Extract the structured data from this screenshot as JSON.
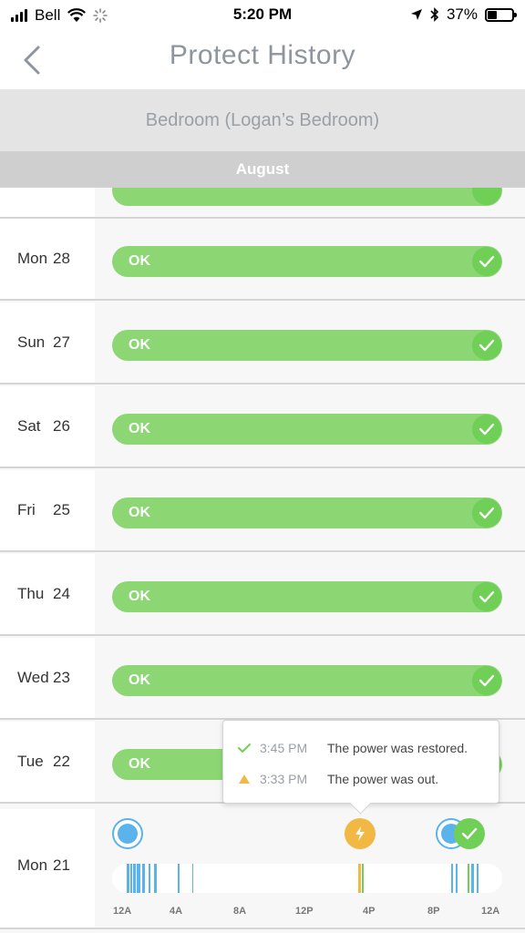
{
  "status_bar": {
    "carrier": "Bell",
    "time": "5:20 PM",
    "battery": "37%",
    "battery_level": 0.37
  },
  "nav": {
    "title": "Protect History"
  },
  "device": {
    "name": "Bedroom (Logan’s Bedroom)"
  },
  "month": "August",
  "rows": [
    {
      "day": "Mon",
      "date": "28",
      "status": "OK"
    },
    {
      "day": "Sun",
      "date": "27",
      "status": "OK"
    },
    {
      "day": "Sat",
      "date": "26",
      "status": "OK"
    },
    {
      "day": "Fri",
      "date": "25",
      "status": "OK"
    },
    {
      "day": "Thu",
      "date": "24",
      "status": "OK"
    },
    {
      "day": "Wed",
      "date": "23",
      "status": "OK"
    },
    {
      "day": "Tue",
      "date": "22",
      "status": "OK"
    }
  ],
  "timeline": {
    "day": "Mon",
    "date": "21",
    "axis": [
      "12A",
      "4A",
      "8A",
      "12P",
      "4P",
      "8P",
      "12A"
    ]
  },
  "popover": {
    "events": [
      {
        "time": "3:45 PM",
        "message": "The power was restored.",
        "icon": "check-icon"
      },
      {
        "time": "3:33 PM",
        "message": "The power was out.",
        "icon": "warning-icon"
      }
    ]
  },
  "colors": {
    "ok_green": "#8cd674",
    "check_green": "#6fcf57",
    "blue": "#5ab3ea",
    "orange": "#f2b844",
    "title_gray": "#8e959c"
  }
}
